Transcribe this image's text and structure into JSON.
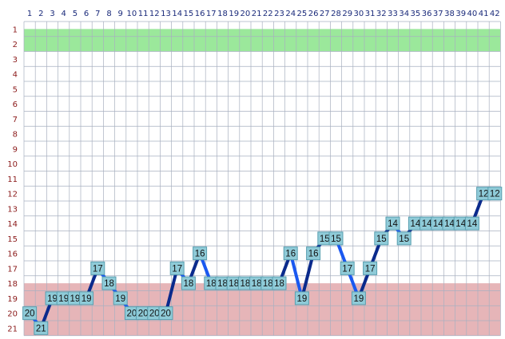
{
  "chart_data": {
    "type": "line",
    "x": [
      1,
      2,
      3,
      4,
      5,
      6,
      7,
      8,
      9,
      10,
      11,
      12,
      13,
      14,
      15,
      16,
      17,
      18,
      19,
      20,
      21,
      22,
      23,
      24,
      25,
      26,
      27,
      28,
      29,
      30,
      31,
      32,
      33,
      34,
      35,
      36,
      37,
      38,
      39,
      40,
      41,
      42
    ],
    "x_tick_labels": [
      "1",
      "2",
      "3",
      "4",
      "5",
      "6",
      "7",
      "8",
      "9",
      "10",
      "11",
      "12",
      "13",
      "14",
      "15",
      "16",
      "17",
      "18",
      "19",
      "20",
      "21",
      "22",
      "23",
      "24",
      "25",
      "26",
      "27",
      "28",
      "29",
      "30",
      "31",
      "32",
      "33",
      "34",
      "35",
      "36",
      "37",
      "38",
      "39",
      "40",
      "41",
      "42"
    ],
    "y_tick_labels": [
      "1",
      "2",
      "3",
      "4",
      "5",
      "6",
      "7",
      "8",
      "9",
      "10",
      "11",
      "12",
      "13",
      "14",
      "15",
      "16",
      "17",
      "18",
      "19",
      "20",
      "21"
    ],
    "ylim": [
      1,
      21
    ],
    "y_inverted": true,
    "grid": true,
    "bands": [
      {
        "from": 1,
        "to": 2,
        "color": "#9be89b"
      },
      {
        "from": 18,
        "to": 21,
        "color": "#e6b5b8"
      }
    ],
    "series": [
      {
        "values": [
          20,
          21,
          19,
          19,
          19,
          19,
          17,
          18,
          19,
          20,
          20,
          20,
          20,
          17,
          18,
          16,
          18,
          18,
          18,
          18,
          18,
          18,
          18,
          16,
          19,
          16,
          15,
          15,
          17,
          19,
          17,
          15,
          14,
          15,
          14,
          14,
          14,
          14,
          14,
          14,
          12,
          12
        ]
      }
    ],
    "colors": {
      "line_rising": "#0a2a8c",
      "line_falling": "#1a58f0",
      "label_box": "#8fcbd8",
      "label_border": "#5a9fb0",
      "grid": "#a8b0c0",
      "x_tick": "#1a2a7a",
      "y_tick": "#8b1a1a"
    }
  }
}
